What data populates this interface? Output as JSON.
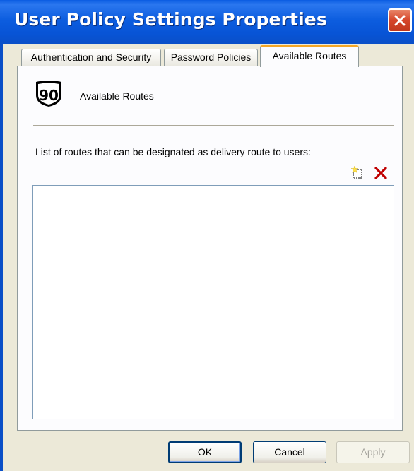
{
  "window": {
    "title": "User Policy Settings Properties"
  },
  "tabs": [
    {
      "label": "Authentication and Security",
      "active": false
    },
    {
      "label": "Password Policies",
      "active": false
    },
    {
      "label": "Available Routes",
      "active": true
    }
  ],
  "panel": {
    "header_icon": "route-90-shield-icon",
    "shield_number": "90",
    "header_label": "Available Routes",
    "list_caption": "List of routes that can be designated as delivery route to users:",
    "toolbar": {
      "new_icon": "new-item-icon",
      "delete_icon": "delete-x-icon"
    },
    "routes": []
  },
  "buttons": {
    "ok": "OK",
    "cancel": "Cancel",
    "apply": "Apply"
  },
  "colors": {
    "titlebar": "#0a5ce2",
    "close_button": "#d5452a",
    "active_tab_accent": "#f5a725",
    "delete_icon": "#c00000"
  }
}
